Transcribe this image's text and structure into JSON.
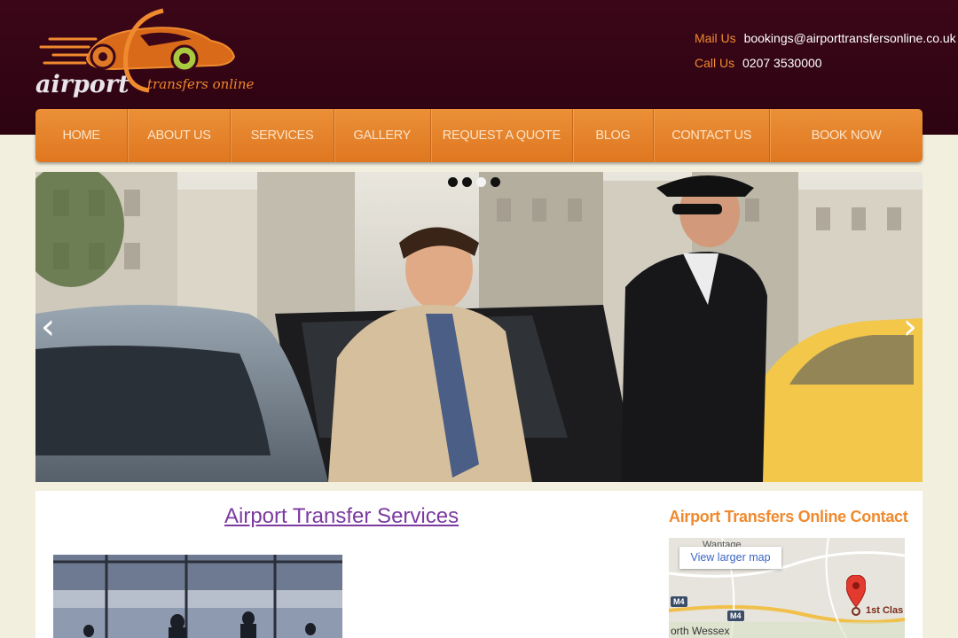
{
  "header": {
    "logo_main": "airport",
    "logo_sub": "transfers online",
    "mail_label": "Mail Us",
    "mail_value": "bookings@airporttransfersonline.co.uk",
    "call_label": "Call Us",
    "call_value": "0207 3530000"
  },
  "nav": {
    "items": [
      {
        "label": "HOME"
      },
      {
        "label": "ABOUT US"
      },
      {
        "label": "SERVICES"
      },
      {
        "label": "GALLERY"
      },
      {
        "label": "REQUEST A QUOTE"
      },
      {
        "label": "BLOG"
      },
      {
        "label": "CONTACT US"
      },
      {
        "label": "BOOK NOW"
      }
    ]
  },
  "slider": {
    "prev_icon": "chevron-left-icon",
    "next_icon": "chevron-right-icon",
    "prev_glyph": "‹",
    "next_glyph": "›",
    "dots": 4,
    "active_dot": 3
  },
  "main": {
    "title": "Airport Transfer Services"
  },
  "sidebar": {
    "title": "Airport Transfers Online Contact",
    "map_button": "View larger map",
    "map_labels": {
      "place_top": "Wantage",
      "place_bottom": "orth Wessex",
      "road_1": "M4",
      "road_2": "M4",
      "marker": "1st Clas"
    }
  },
  "colors": {
    "header_bg": "#3b0718",
    "nav_orange": "#e48228",
    "accent_orange": "#ef8a2e",
    "link_purple": "#7b3aa0",
    "page_bg": "#f3efdf"
  }
}
